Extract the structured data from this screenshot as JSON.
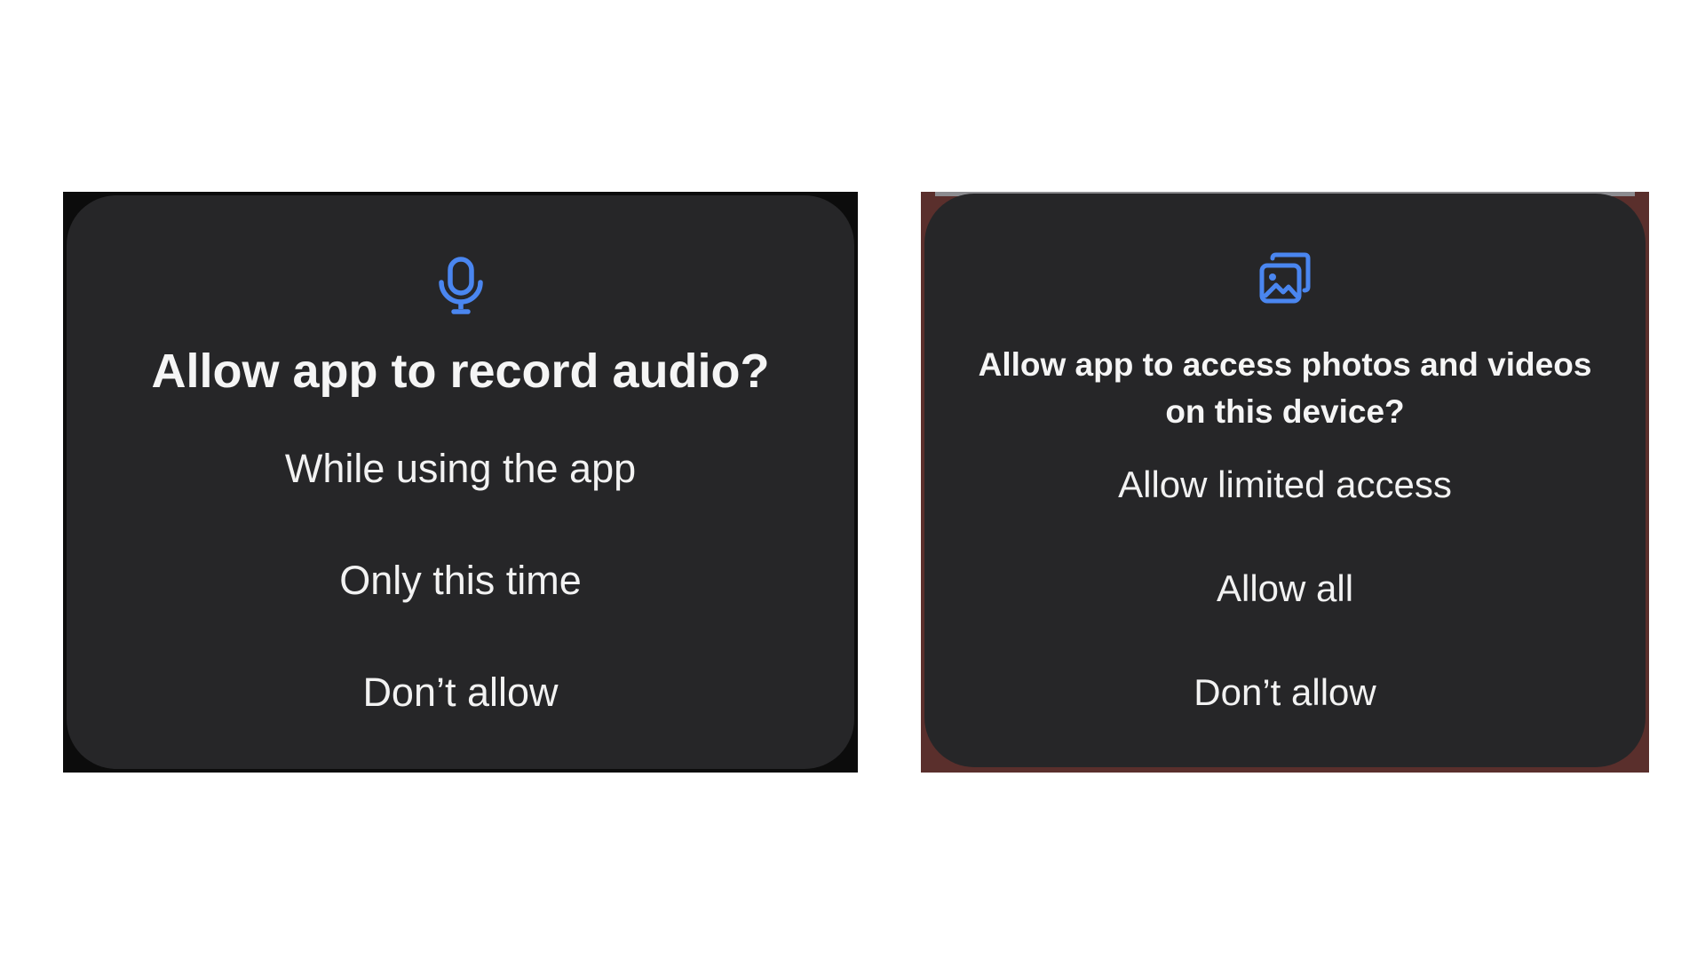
{
  "audio_dialog": {
    "icon": "microphone-icon",
    "title": "Allow app to record audio?",
    "options": [
      "While using the app",
      "Only this time",
      "Don’t allow"
    ]
  },
  "media_dialog": {
    "icon": "photos-icon",
    "title_line1": "Allow app to access photos and videos",
    "title_line2": "on this device?",
    "options": [
      "Allow limited access",
      "Allow all",
      "Don’t allow"
    ]
  },
  "colors": {
    "accent": "#4a86f0",
    "dialog_background": "#262628",
    "text": "#f2f2f2"
  }
}
